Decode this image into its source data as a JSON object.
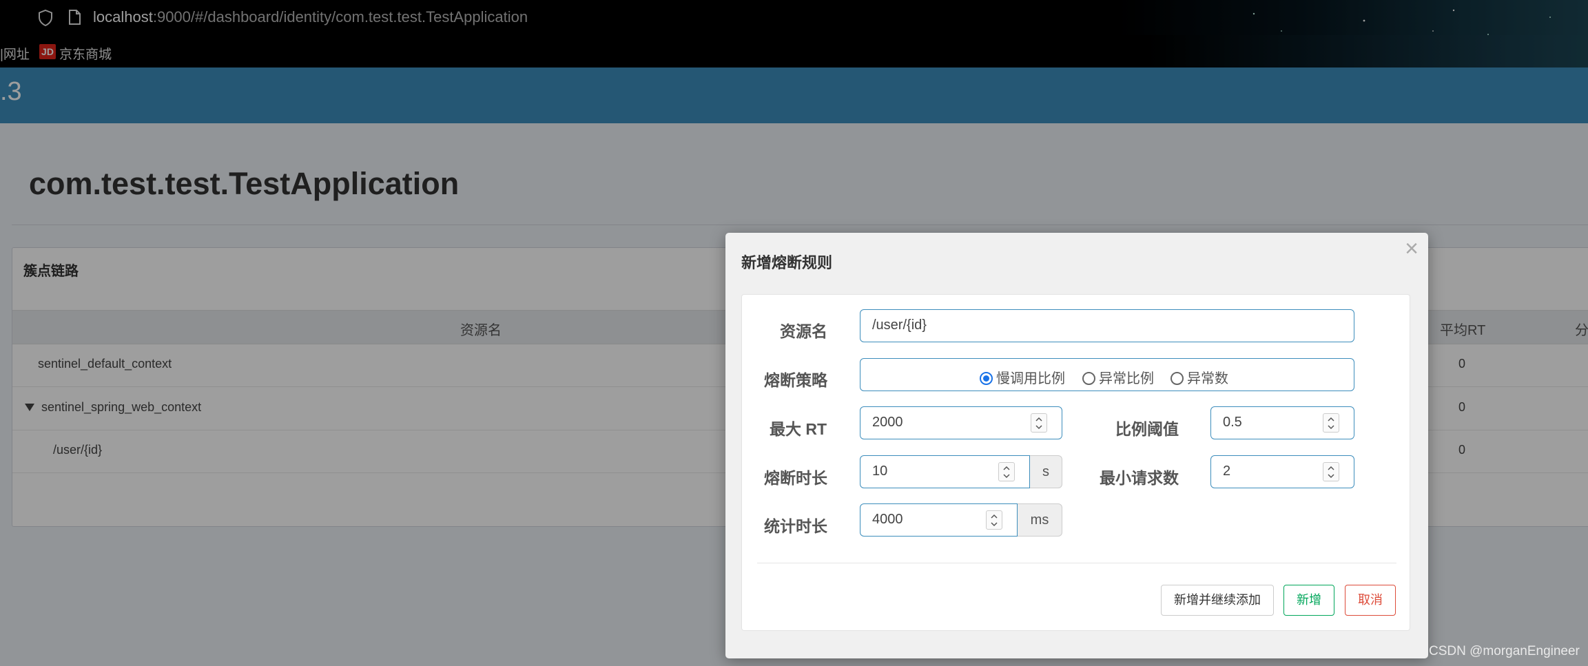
{
  "browser": {
    "url_host": "localhost",
    "url_rest": ":9000/#/dashboard/identity/com.test.test.TestApplication",
    "bookmark_partial": "|网址",
    "bookmark_jd_logo": "JD",
    "bookmark_jd": "京东商城"
  },
  "header": {
    "version_fragment": ".3"
  },
  "page": {
    "title": "com.test.test.TestApplication",
    "box_title": "簇点链路",
    "columns": {
      "resource": "资源名",
      "avg_rt": "平均RT",
      "partial": "分"
    },
    "rows": [
      {
        "name": "sentinel_default_context",
        "avg_rt": "0"
      },
      {
        "name": "sentinel_spring_web_context",
        "avg_rt": "0"
      },
      {
        "name": "/user/{id}",
        "avg_rt": "0"
      }
    ]
  },
  "modal": {
    "title": "新增熔断规则",
    "close": "×",
    "labels": {
      "resource": "资源名",
      "strategy": "熔断策略",
      "max_rt": "最大 RT",
      "ratio": "比例阈值",
      "break_time": "熔断时长",
      "min_requests": "最小请求数",
      "stat_time": "统计时长"
    },
    "values": {
      "resource": "/user/{id}",
      "max_rt": "2000",
      "ratio": "0.5",
      "break_time": "10",
      "min_requests": "2",
      "stat_time": "4000"
    },
    "units": {
      "break_time": "s",
      "stat_time": "ms"
    },
    "strategy_options": [
      "慢调用比例",
      "异常比例",
      "异常数"
    ],
    "strategy_selected": "慢调用比例",
    "buttons": {
      "add_continue": "新增并继续添加",
      "add": "新增",
      "cancel": "取消"
    }
  },
  "watermark": "CSDN @morganEngineer",
  "colors": {
    "header": "#3c8dbc",
    "success": "#00a65a",
    "danger": "#dd4b39",
    "radio": "#1a73e8"
  }
}
